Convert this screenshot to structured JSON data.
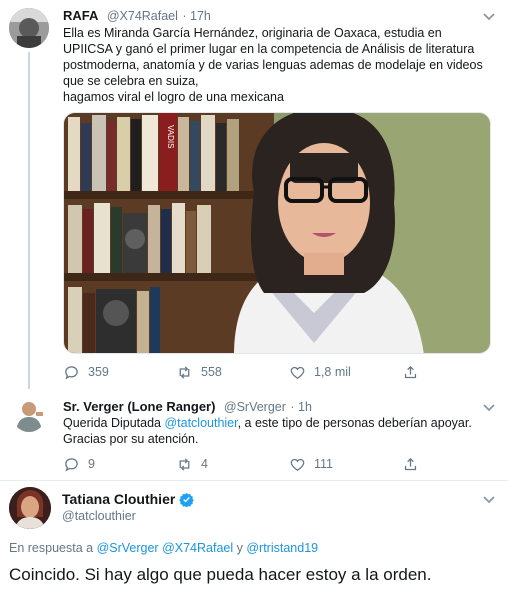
{
  "tweet1": {
    "name": "RAFA",
    "handle": "@X74Rafael",
    "time": "· 17h",
    "lines": [
      "Ella es Miranda García Hernández, originaria de Oaxaca, estudia en",
      "UPIICSA y ganó el primer lugar en la competencia de Análisis de literatura",
      "postmoderna, anatomía y de varias lenguas ademas de modelaje en videos",
      "que se celebra en suiza,",
      "hagamos viral el logro de una mexicana"
    ],
    "book_spine_text": "VADIS",
    "replies": "359",
    "retweets": "558",
    "likes": "1,8 mil"
  },
  "tweet2": {
    "name": "Sr. Verger (Lone Ranger)",
    "handle": "@SrVerger",
    "time": "· 1h",
    "line1_prefix": "Querida Diputada ",
    "line1_mention": "@tatclouthier",
    "line1_suffix": ", a este tipo de personas deberían apoyar.",
    "line2": "Gracias por su atención.",
    "replies": "9",
    "retweets": "4",
    "likes": "111"
  },
  "tweet3": {
    "name": "Tatiana Clouthier",
    "handle": "@tatclouthier",
    "reply_prefix": "En respuesta a ",
    "reply_mention1": "@SrVerger",
    "reply_mention2": "@X74Rafael",
    "reply_and": " y ",
    "reply_mention3": "@rtristand19",
    "text": "Coincido. Si hay algo que pueda hacer estoy a la orden."
  },
  "colors": {
    "link": "#1b95e0",
    "muted": "#657786",
    "verified": "#1da1f2"
  }
}
